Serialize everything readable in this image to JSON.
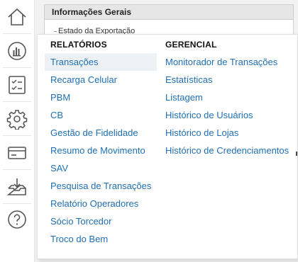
{
  "panel": {
    "title": "Informações Gerais",
    "legend": "Estado da Exportação"
  },
  "rail": {
    "items": [
      {
        "icon": "home-icon"
      },
      {
        "icon": "reports-chart-icon"
      },
      {
        "icon": "checklist-icon"
      },
      {
        "icon": "gear-icon"
      },
      {
        "icon": "card-icon"
      },
      {
        "icon": "inbox-download-icon"
      },
      {
        "icon": "help-icon"
      }
    ]
  },
  "menu": {
    "col1": {
      "heading": "RELATÓRIOS",
      "items": [
        "Transações",
        "Recarga Celular",
        "PBM",
        "CB",
        "Gestão de Fidelidade",
        "Resumo de Movimento",
        "SAV",
        "Pesquisa de Transações",
        "Relatório Operadores",
        "Sócio Torcedor",
        "Troco do Bem"
      ],
      "active_index": 0
    },
    "col2": {
      "heading": "GERENCIAL",
      "items": [
        "Monitorador de Transações",
        "Estatísticas",
        "Listagem",
        "Histórico de Usuários",
        "Histórico de Lojas",
        "Histórico de Credenciamentos"
      ]
    }
  },
  "colors": {
    "link": "#1e6fb4",
    "active_bg": "#eef1f4",
    "icon": "#555555"
  }
}
